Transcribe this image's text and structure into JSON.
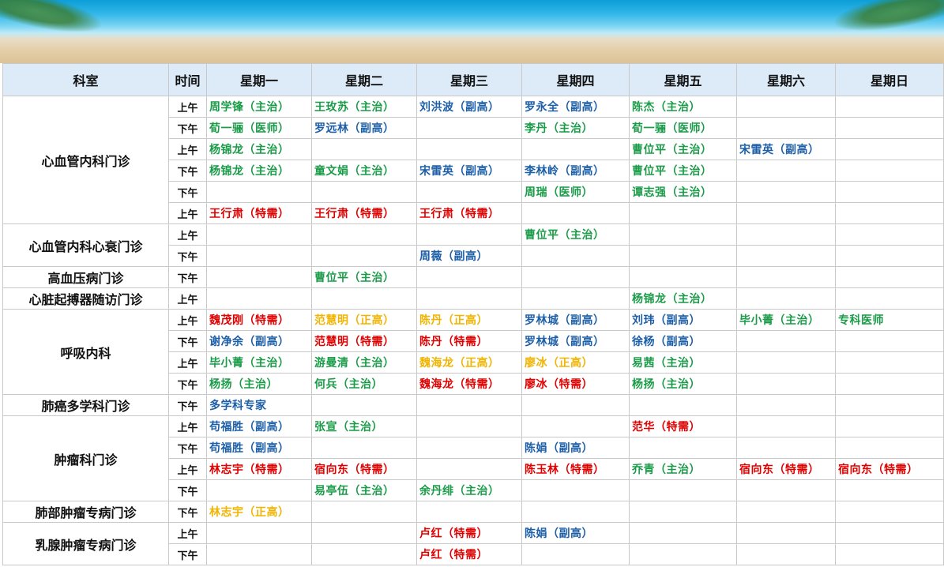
{
  "header": {
    "dept": "科室",
    "time": "时间",
    "days": [
      "星期一",
      "星期二",
      "星期三",
      "星期四",
      "星期五",
      "星期六",
      "星期日"
    ]
  },
  "colors": {
    "g": "#1a9b48",
    "b": "#1c5fa8",
    "r": "#e00000",
    "o": "#f0b400"
  },
  "departments": [
    {
      "name": "心血管内科门诊",
      "rows": [
        {
          "time": "上午",
          "cells": [
            [
              "周学锋（主治）",
              "g"
            ],
            [
              "王玫苏（主治）",
              "g"
            ],
            [
              "刘洪波（副高）",
              "b"
            ],
            [
              "罗永全（副高）",
              "b"
            ],
            [
              "陈杰（主治）",
              "g"
            ],
            [
              "",
              ""
            ],
            [
              "",
              ""
            ]
          ]
        },
        {
          "time": "下午",
          "cells": [
            [
              "荀一骊（医师）",
              "g"
            ],
            [
              "罗远林（副高）",
              "b"
            ],
            [
              "",
              ""
            ],
            [
              "李丹（主治）",
              "g"
            ],
            [
              "荀一骊（医师）",
              "g"
            ],
            [
              "",
              ""
            ],
            [
              "",
              ""
            ]
          ]
        },
        {
          "time": "上午",
          "cells": [
            [
              "杨锦龙（主治）",
              "g"
            ],
            [
              "",
              ""
            ],
            [
              "",
              ""
            ],
            [
              "",
              ""
            ],
            [
              "曹位平（主治）",
              "g"
            ],
            [
              "宋雷英（副高）",
              "b"
            ],
            [
              "",
              ""
            ]
          ]
        },
        {
          "time": "下午",
          "cells": [
            [
              "杨锦龙（主治）",
              "g"
            ],
            [
              "童文娟（主治）",
              "g"
            ],
            [
              "宋雷英（副高）",
              "b"
            ],
            [
              "李林岭（副高）",
              "b"
            ],
            [
              "曹位平（主治）",
              "g"
            ],
            [
              "",
              ""
            ],
            [
              "",
              ""
            ]
          ]
        },
        {
          "time": "下午",
          "cells": [
            [
              "",
              ""
            ],
            [
              "",
              ""
            ],
            [
              "",
              ""
            ],
            [
              "周瑞（医师）",
              "g"
            ],
            [
              "谭志强（主治）",
              "g"
            ],
            [
              "",
              ""
            ],
            [
              "",
              ""
            ]
          ]
        },
        {
          "time": "上午",
          "cells": [
            [
              "王行肃（特需）",
              "r"
            ],
            [
              "王行肃（特需）",
              "r"
            ],
            [
              "王行肃（特需）",
              "r"
            ],
            [
              "",
              ""
            ],
            [
              "",
              ""
            ],
            [
              "",
              ""
            ],
            [
              "",
              ""
            ]
          ]
        }
      ]
    },
    {
      "name": "心血管内科心衰门诊",
      "rows": [
        {
          "time": "上午",
          "cells": [
            [
              "",
              ""
            ],
            [
              "",
              ""
            ],
            [
              "",
              ""
            ],
            [
              "曹位平（主治）",
              "g"
            ],
            [
              "",
              ""
            ],
            [
              "",
              ""
            ],
            [
              "",
              ""
            ]
          ]
        },
        {
          "time": "下午",
          "cells": [
            [
              "",
              ""
            ],
            [
              "",
              ""
            ],
            [
              "周薇（副高）",
              "b"
            ],
            [
              "",
              ""
            ],
            [
              "",
              ""
            ],
            [
              "",
              ""
            ],
            [
              "",
              ""
            ]
          ]
        }
      ]
    },
    {
      "name": "高血压病门诊",
      "rows": [
        {
          "time": "下午",
          "cells": [
            [
              "",
              ""
            ],
            [
              "曹位平（主治）",
              "g"
            ],
            [
              "",
              ""
            ],
            [
              "",
              ""
            ],
            [
              "",
              ""
            ],
            [
              "",
              ""
            ],
            [
              "",
              ""
            ]
          ]
        }
      ]
    },
    {
      "name": "心脏起搏器随访门诊",
      "rows": [
        {
          "time": "上午",
          "cells": [
            [
              "",
              ""
            ],
            [
              "",
              ""
            ],
            [
              "",
              ""
            ],
            [
              "",
              ""
            ],
            [
              "杨锦龙（主治）",
              "g"
            ],
            [
              "",
              ""
            ],
            [
              "",
              ""
            ]
          ]
        }
      ]
    },
    {
      "name": "呼吸内科",
      "rows": [
        {
          "time": "上午",
          "cells": [
            [
              "魏茂刚（特需）",
              "r"
            ],
            [
              "范慧明（正高）",
              "o"
            ],
            [
              "陈丹（正高）",
              "o"
            ],
            [
              "罗林城（副高）",
              "b"
            ],
            [
              "刘玮（副高）",
              "b"
            ],
            [
              "毕小菁（主治）",
              "g"
            ],
            [
              "专科医师",
              "g"
            ]
          ]
        },
        {
          "time": "下午",
          "cells": [
            [
              "谢净余（副高）",
              "b"
            ],
            [
              "范慧明（特需）",
              "r"
            ],
            [
              "陈丹（特需）",
              "r"
            ],
            [
              "罗林城（副高）",
              "b"
            ],
            [
              "徐杨（副高）",
              "b"
            ],
            [
              "",
              ""
            ],
            [
              "",
              ""
            ]
          ]
        },
        {
          "time": "上午",
          "cells": [
            [
              "毕小菁（主治）",
              "g"
            ],
            [
              "游曼清（主治）",
              "g"
            ],
            [
              "魏海龙（正高）",
              "o"
            ],
            [
              "廖冰（正高）",
              "o"
            ],
            [
              "易茜（主治）",
              "g"
            ],
            [
              "",
              ""
            ],
            [
              "",
              ""
            ]
          ]
        },
        {
          "time": "下午",
          "cells": [
            [
              "杨扬（主治）",
              "g"
            ],
            [
              "何兵（主治）",
              "g"
            ],
            [
              "魏海龙（特需）",
              "r"
            ],
            [
              "廖冰（特需）",
              "r"
            ],
            [
              "杨扬（主治）",
              "g"
            ],
            [
              "",
              ""
            ],
            [
              "",
              ""
            ]
          ]
        }
      ]
    },
    {
      "name": "肺癌多学科门诊",
      "rows": [
        {
          "time": "下午",
          "cells": [
            [
              "多学科专家",
              "b"
            ],
            [
              "",
              ""
            ],
            [
              "",
              ""
            ],
            [
              "",
              ""
            ],
            [
              "",
              ""
            ],
            [
              "",
              ""
            ],
            [
              "",
              ""
            ]
          ]
        }
      ]
    },
    {
      "name": "肿瘤科门诊",
      "rows": [
        {
          "time": "上午",
          "cells": [
            [
              "苟福胜（副高）",
              "b"
            ],
            [
              "张宣（主治）",
              "g"
            ],
            [
              "",
              ""
            ],
            [
              "",
              ""
            ],
            [
              "范华（特需）",
              "r"
            ],
            [
              "",
              ""
            ],
            [
              "",
              ""
            ]
          ]
        },
        {
          "time": "下午",
          "cells": [
            [
              "苟福胜（副高）",
              "b"
            ],
            [
              "",
              ""
            ],
            [
              "",
              ""
            ],
            [
              "陈娟（副高）",
              "b"
            ],
            [
              "",
              ""
            ],
            [
              "",
              ""
            ],
            [
              "",
              ""
            ]
          ]
        },
        {
          "time": "上午",
          "cells": [
            [
              "林志宇（特需）",
              "r"
            ],
            [
              "宿向东（特需）",
              "r"
            ],
            [
              "",
              ""
            ],
            [
              "陈玉林（特需）",
              "r"
            ],
            [
              "乔青（主治）",
              "g"
            ],
            [
              "宿向东（特需）",
              "r"
            ],
            [
              "宿向东（特需）",
              "r"
            ]
          ]
        },
        {
          "time": "下午",
          "cells": [
            [
              "",
              ""
            ],
            [
              "易亭伍（主治）",
              "g"
            ],
            [
              "余丹绯（主治）",
              "g"
            ],
            [
              "",
              ""
            ],
            [
              "",
              ""
            ],
            [
              "",
              ""
            ],
            [
              "",
              ""
            ]
          ]
        }
      ]
    },
    {
      "name": "肺部肿瘤专病门诊",
      "rows": [
        {
          "time": "下午",
          "cells": [
            [
              "林志宇（正高）",
              "o"
            ],
            [
              "",
              ""
            ],
            [
              "",
              ""
            ],
            [
              "",
              ""
            ],
            [
              "",
              ""
            ],
            [
              "",
              ""
            ],
            [
              "",
              ""
            ]
          ]
        }
      ]
    },
    {
      "name": "乳腺肿瘤专病门诊",
      "rows": [
        {
          "time": "上午",
          "cells": [
            [
              "",
              ""
            ],
            [
              "",
              ""
            ],
            [
              "卢红（特需）",
              "r"
            ],
            [
              "陈娟（副高）",
              "b"
            ],
            [
              "",
              ""
            ],
            [
              "",
              ""
            ],
            [
              "",
              ""
            ]
          ]
        },
        {
          "time": "下午",
          "cells": [
            [
              "",
              ""
            ],
            [
              "",
              ""
            ],
            [
              "卢红（特需）",
              "r"
            ],
            [
              "",
              ""
            ],
            [
              "",
              ""
            ],
            [
              "",
              ""
            ],
            [
              "",
              ""
            ]
          ]
        }
      ]
    }
  ]
}
